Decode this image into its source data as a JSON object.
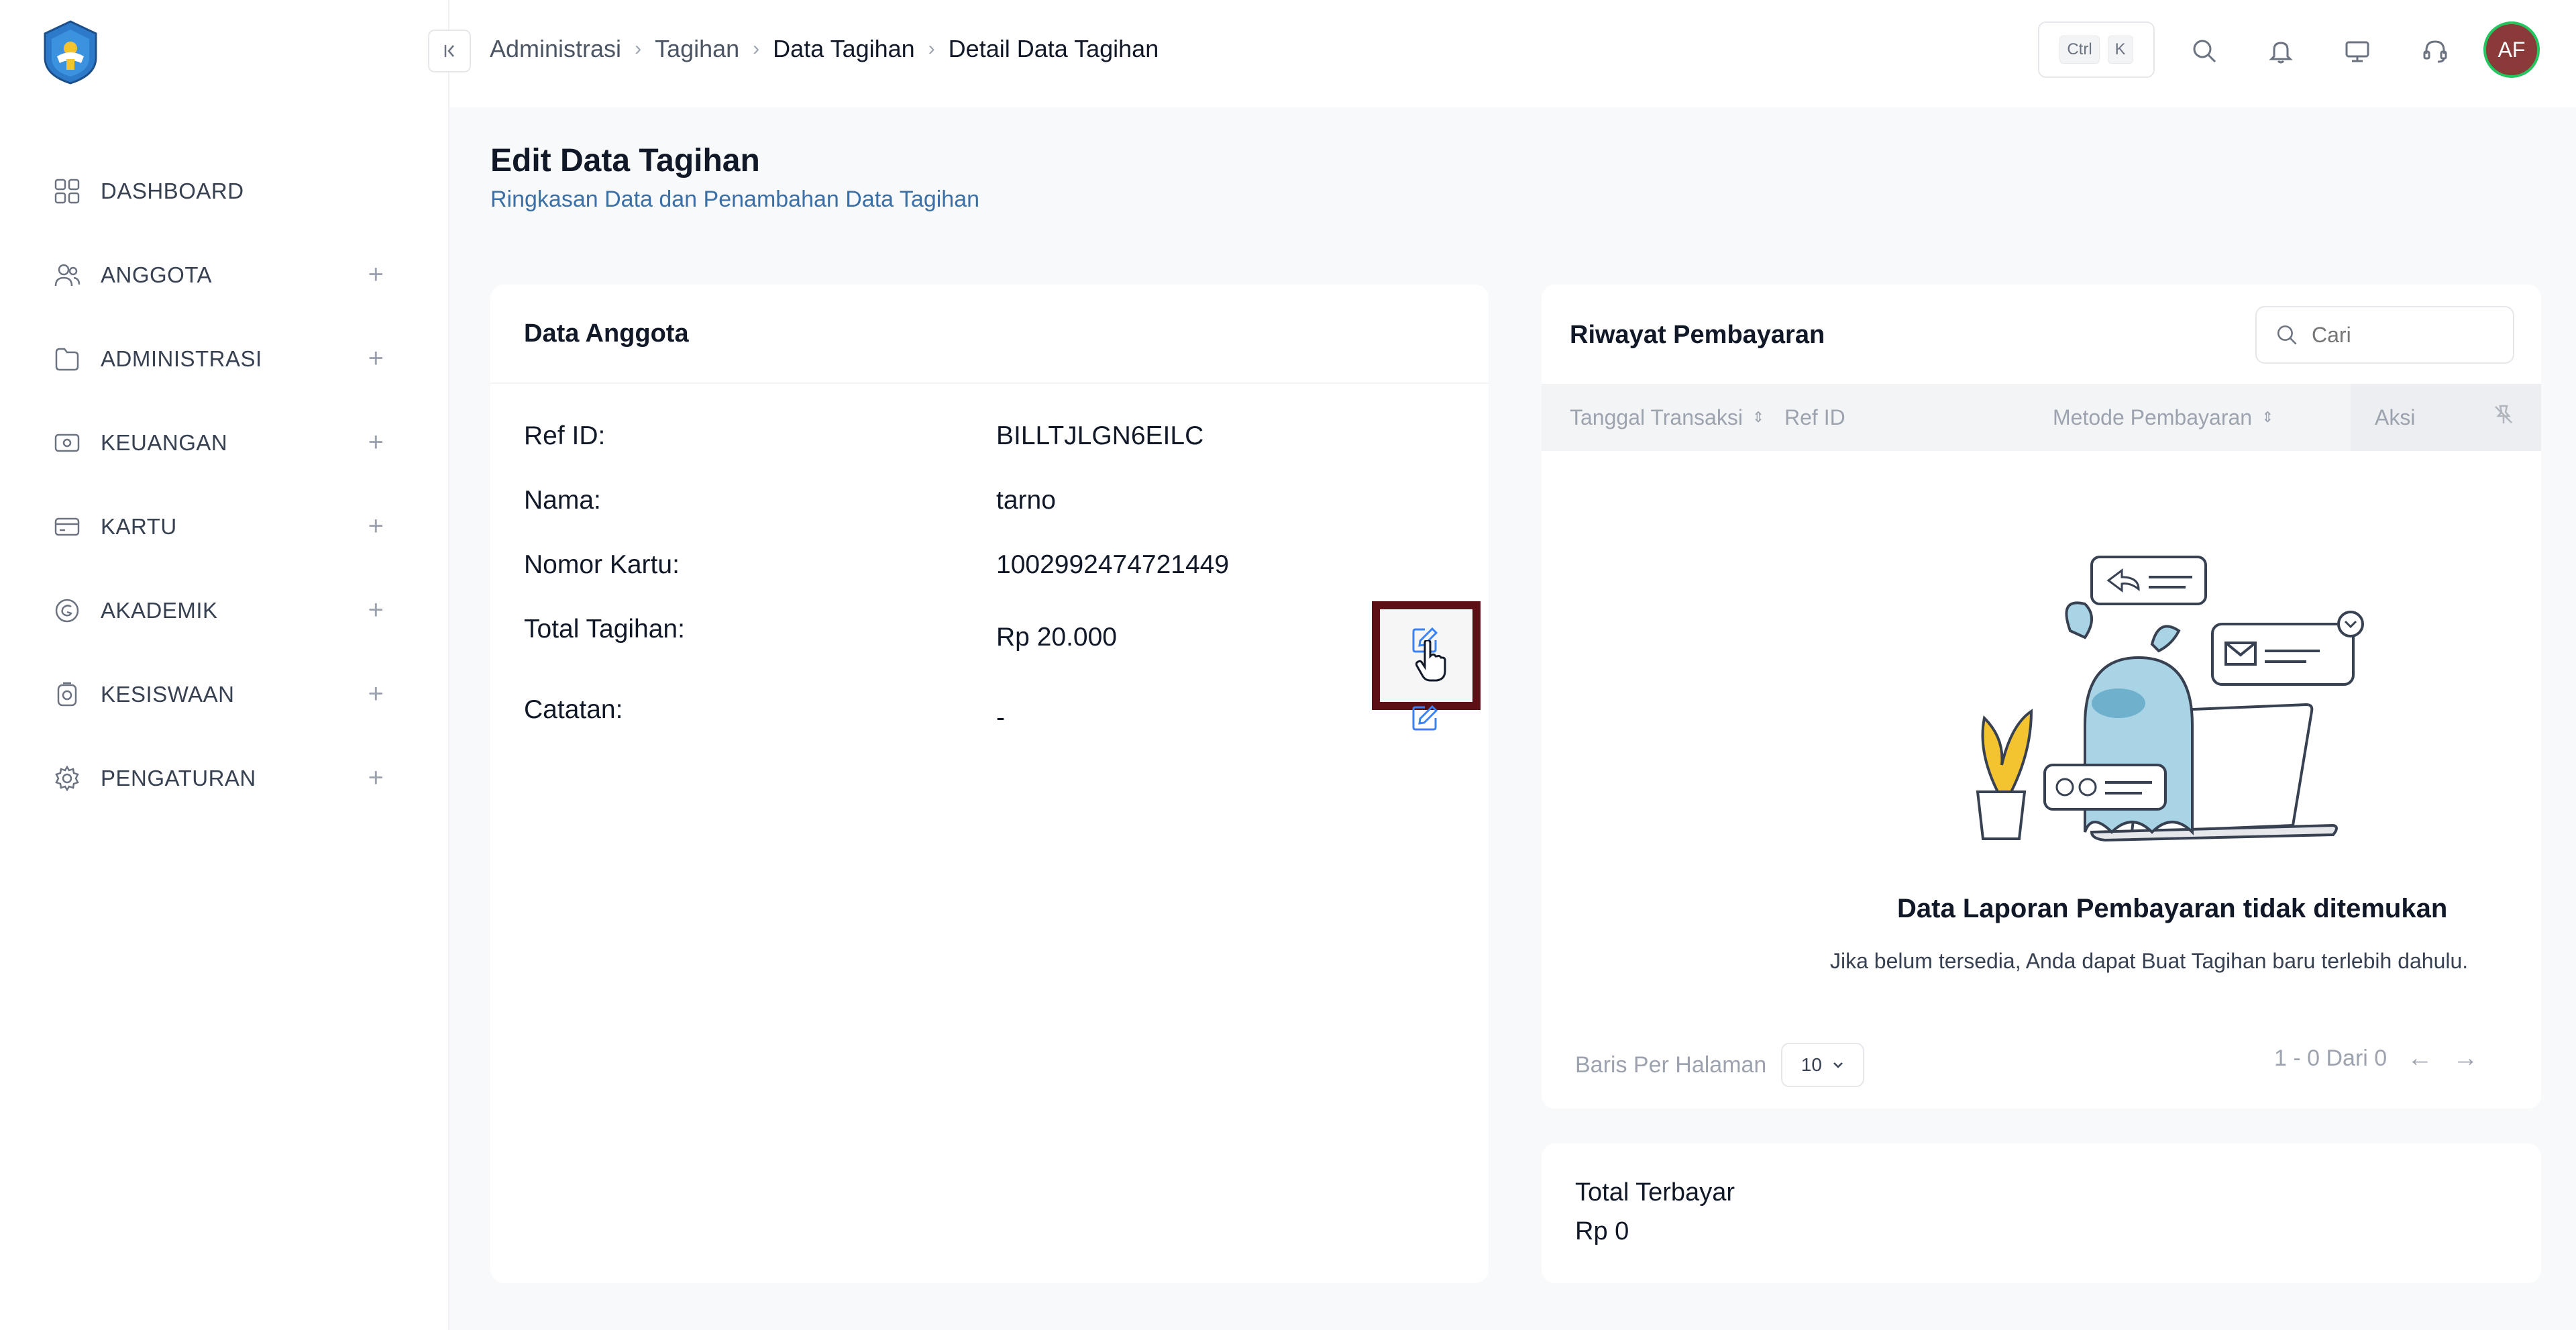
{
  "header": {
    "breadcrumb": [
      "Administrasi",
      "Tagihan",
      "Data Tagihan",
      "Detail Data Tagihan"
    ],
    "kbd_ctrl": "Ctrl",
    "kbd_k": "K",
    "avatar_initials": "AF"
  },
  "sidebar": {
    "items": [
      {
        "label": "DASHBOARD",
        "icon": "grid-icon",
        "expandable": false
      },
      {
        "label": "ANGGOTA",
        "icon": "users-icon",
        "expandable": true
      },
      {
        "label": "ADMINISTRASI",
        "icon": "folder-icon",
        "expandable": true
      },
      {
        "label": "KEUANGAN",
        "icon": "money-icon",
        "expandable": true
      },
      {
        "label": "KARTU",
        "icon": "card-icon",
        "expandable": true
      },
      {
        "label": "AKADEMIK",
        "icon": "academic-icon",
        "expandable": true
      },
      {
        "label": "KESISWAAN",
        "icon": "student-icon",
        "expandable": true
      },
      {
        "label": "PENGATURAN",
        "icon": "gear-icon",
        "expandable": true
      }
    ],
    "plus": "+"
  },
  "page": {
    "title": "Edit Data Tagihan",
    "subtitle": "Ringkasan Data dan Penambahan Data Tagihan"
  },
  "member_card": {
    "title": "Data Anggota",
    "fields": [
      {
        "label": "Ref ID:",
        "value": "BILLTJLGN6EILC"
      },
      {
        "label": "Nama:",
        "value": "tarno"
      },
      {
        "label": "Nomor Kartu:",
        "value": "1002992474721449"
      },
      {
        "label": "Total Tagihan:",
        "value": "Rp 20.000"
      },
      {
        "label": "Catatan:",
        "value": "-"
      }
    ]
  },
  "payment_card": {
    "title": "Riwayat Pembayaran",
    "search_placeholder": "Cari",
    "columns": [
      "Tanggal Transaksi",
      "Ref ID",
      "Metode Pembayaran",
      "Aksi"
    ],
    "empty_title": "Data Laporan Pembayaran tidak ditemukan",
    "empty_subtitle": "Jika belum tersedia, Anda dapat Buat Tagihan baru terlebih dahulu.",
    "rows_per_page_label": "Baris Per Halaman",
    "rows_per_page_value": "10",
    "pagination_text": "1 - 0 Dari 0",
    "prev_arrow": "←",
    "next_arrow": "→"
  },
  "total_card": {
    "label": "Total Terbayar",
    "value": "Rp 0"
  },
  "colors": {
    "accent": "#3b82f6",
    "subtitle": "#3b6fa6",
    "highlight_border": "#5c0f14",
    "avatar_bg": "#8b3a3a",
    "avatar_ring": "#22c55e"
  }
}
